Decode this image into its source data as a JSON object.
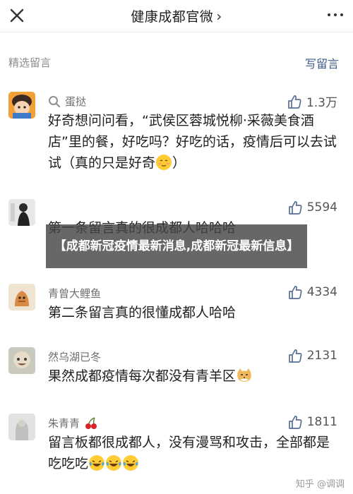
{
  "header": {
    "title": "健康成都官微",
    "title_chevron": "›"
  },
  "section": {
    "left_label": "精选留言",
    "write_label": "写留言"
  },
  "comments": [
    {
      "name": "蛋挞",
      "likes": "1.3万",
      "text": "好奇想问问看，“武侯区蓉城悦柳·采薇美食酒店”里的餐，好吃吗？好吃的话，疫情后可以去试试（真的只是好奇",
      "text_end": "）"
    },
    {
      "name": "",
      "likes": "5594",
      "text": "第一条留言真的很成都人哈哈哈"
    },
    {
      "name": "青曾大鲤鱼",
      "likes": "4334",
      "text": "第二条留言真的很懂成都人哈哈"
    },
    {
      "name": "然乌湖已冬",
      "likes": "2131",
      "text": "果然成都疫情每次都没有青羊区"
    },
    {
      "name": "朱青青",
      "likes": "1811",
      "text": "留言板都很成都人，没有漫骂和攻击，全部都是吃吃吃"
    }
  ],
  "overlay": {
    "text": "【成都新冠疫情最新消息,成都新冠最新信息】"
  },
  "watermark": {
    "text": "知乎 @调调"
  },
  "colors": {
    "link": "#3d5a8c",
    "overlay_bg": "#464646",
    "name_gray": "#6e6e6e"
  },
  "icons": [
    "close-icon",
    "chevron-right-icon",
    "more-icon",
    "thumb-up-icon",
    "search-icon",
    "blush-emoji-icon",
    "cat-face-emoji-icon",
    "cherry-emoji-icon",
    "laughing-tears-emoji-icon"
  ]
}
